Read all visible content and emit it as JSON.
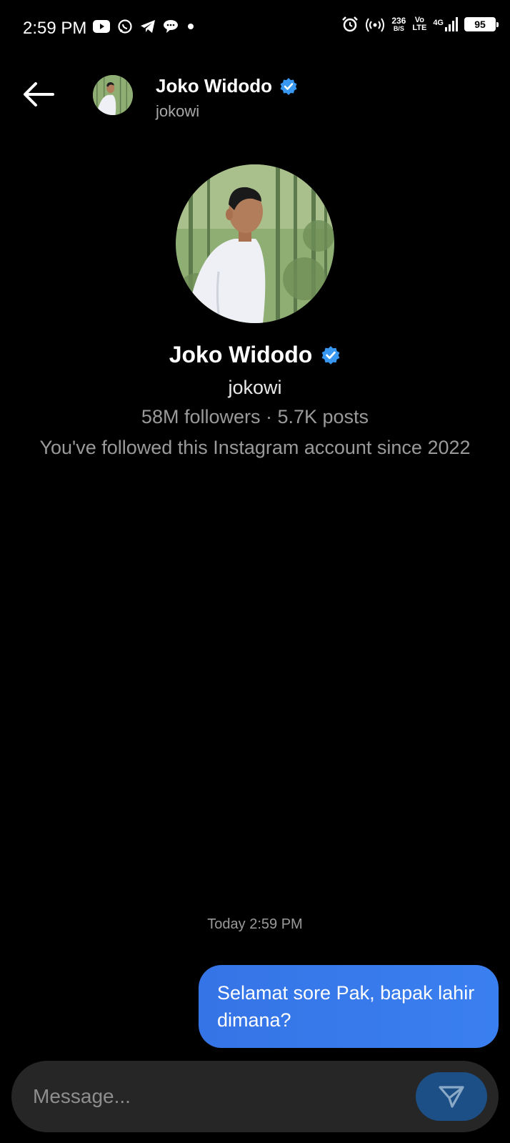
{
  "status_bar": {
    "time": "2:59 PM",
    "left_icons": [
      "youtube-icon",
      "whatsapp-icon",
      "telegram-icon",
      "chat-bubble-icon",
      "dot-icon"
    ],
    "net_speed_value": "236",
    "net_speed_unit": "B/S",
    "volte_top": "Vo",
    "volte_bottom": "LTE",
    "network_type": "4G",
    "battery": "95"
  },
  "header": {
    "name": "Joko Widodo",
    "username": "jokowi",
    "verified": true
  },
  "profile": {
    "name": "Joko Widodo",
    "username": "jokowi",
    "stats": "58M followers · 5.7K posts",
    "follow_note": "You've followed this Instagram account since 2022"
  },
  "chat": {
    "timestamp": "Today 2:59 PM",
    "messages": [
      {
        "text": "Selamat sore Pak, bapak lahir dimana?",
        "sender": "me"
      }
    ]
  },
  "composer": {
    "placeholder": "Message...",
    "value": ""
  },
  "colors": {
    "background": "#000000",
    "bubble": "#3a7ff0",
    "verified_badge": "#3897f0",
    "composer_bg": "#262626",
    "send_button": "#1c4f86"
  }
}
